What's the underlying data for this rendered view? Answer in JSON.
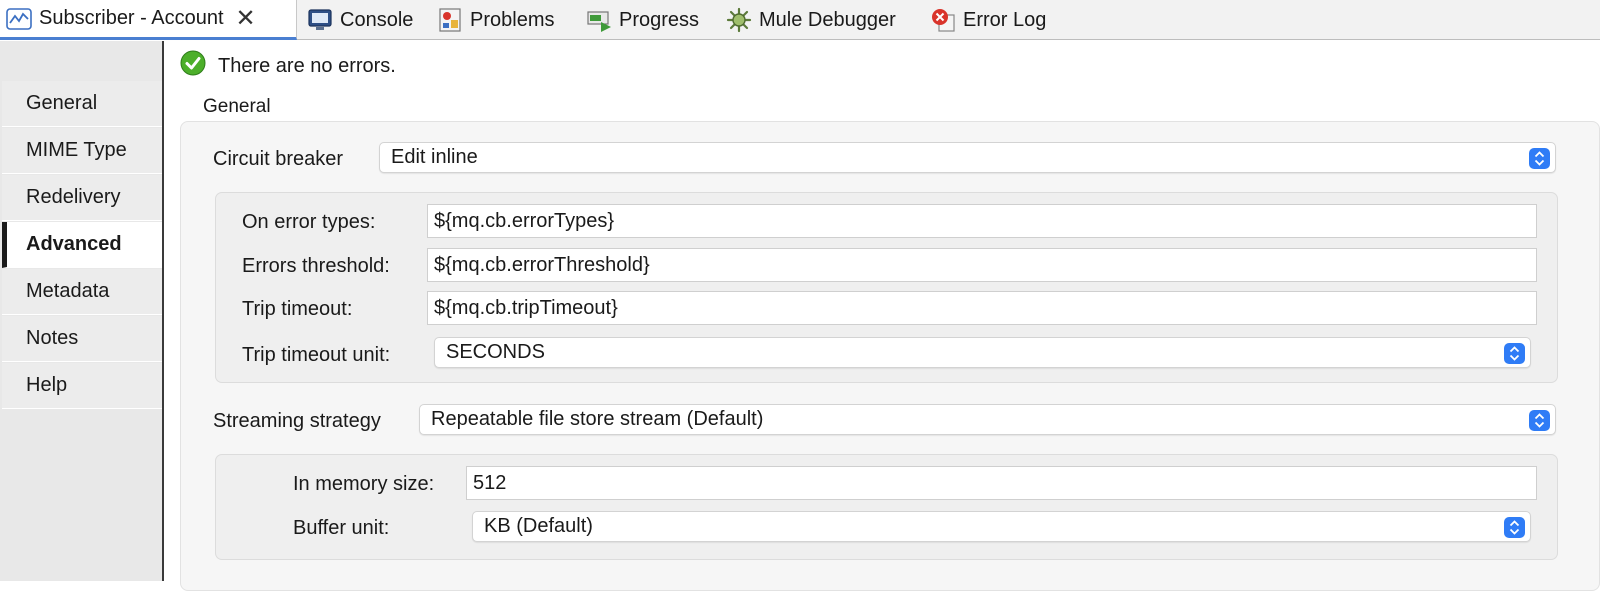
{
  "tabs": [
    {
      "label": "Subscriber - Account",
      "icon": "flow-icon",
      "active": true
    },
    {
      "label": "Console",
      "icon": "console-icon"
    },
    {
      "label": "Problems",
      "icon": "problems-icon"
    },
    {
      "label": "Progress",
      "icon": "progress-icon"
    },
    {
      "label": "Mule Debugger",
      "icon": "debugger-icon"
    },
    {
      "label": "Error Log",
      "icon": "error-log-icon"
    }
  ],
  "nav": {
    "active": "Advanced",
    "items": [
      "General",
      "MIME Type",
      "Redelivery",
      "Advanced",
      "Metadata",
      "Notes",
      "Help"
    ]
  },
  "status": {
    "message": "There are no errors."
  },
  "section_title": "General",
  "circuit_breaker": {
    "label": "Circuit breaker",
    "value": "Edit inline",
    "on_error_types": {
      "label": "On error types:",
      "value": "${mq.cb.errorTypes}"
    },
    "errors_threshold": {
      "label": "Errors threshold:",
      "value": "${mq.cb.errorThreshold}"
    },
    "trip_timeout": {
      "label": "Trip timeout:",
      "value": "${mq.cb.tripTimeout}"
    },
    "trip_timeout_unit": {
      "label": "Trip timeout unit:",
      "value": "SECONDS"
    }
  },
  "streaming": {
    "label": "Streaming strategy",
    "value": "Repeatable file store stream (Default)",
    "in_memory_size": {
      "label": "In memory size:",
      "value": "512"
    },
    "buffer_unit": {
      "label": "Buffer unit:",
      "value": "KB (Default)"
    }
  },
  "colors": {
    "accent": "#2f7cf6",
    "tab_underline": "#4a7fd1",
    "ok": "#4caf2a",
    "error": "#d9342b"
  }
}
